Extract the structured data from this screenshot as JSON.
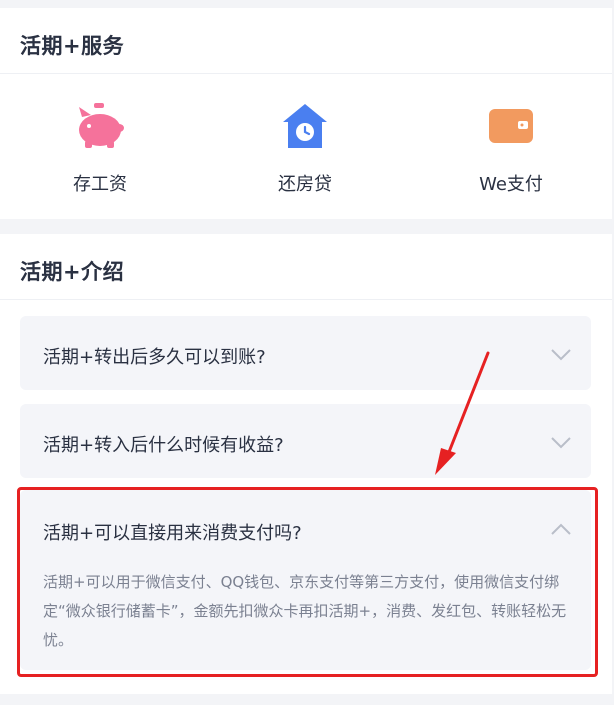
{
  "services": {
    "title": "活期+服务",
    "items": [
      {
        "label": "存工资",
        "icon": "piggy-bank-icon"
      },
      {
        "label": "还房贷",
        "icon": "house-clock-icon"
      },
      {
        "label": "We支付",
        "icon": "wallet-icon"
      }
    ]
  },
  "intro": {
    "title": "活期+介绍",
    "faqs": [
      {
        "question": "活期+转出后多久可以到账?",
        "expanded": false
      },
      {
        "question": "活期+转入后什么时候有收益?",
        "expanded": false
      },
      {
        "question": "活期+可以直接用来消费支付吗?",
        "expanded": true,
        "answer": "活期+可以用于微信支付、QQ钱包、京东支付等第三方支付，使用微信支付绑定“微众银行储蓄卡”，金额先扣微众卡再扣活期+，消费、发红包、转账轻松无忧。"
      }
    ]
  },
  "colors": {
    "piggy": "#f5729b",
    "house": "#4a7ff0",
    "wallet": "#f29a5f",
    "highlight": "#e62122"
  }
}
